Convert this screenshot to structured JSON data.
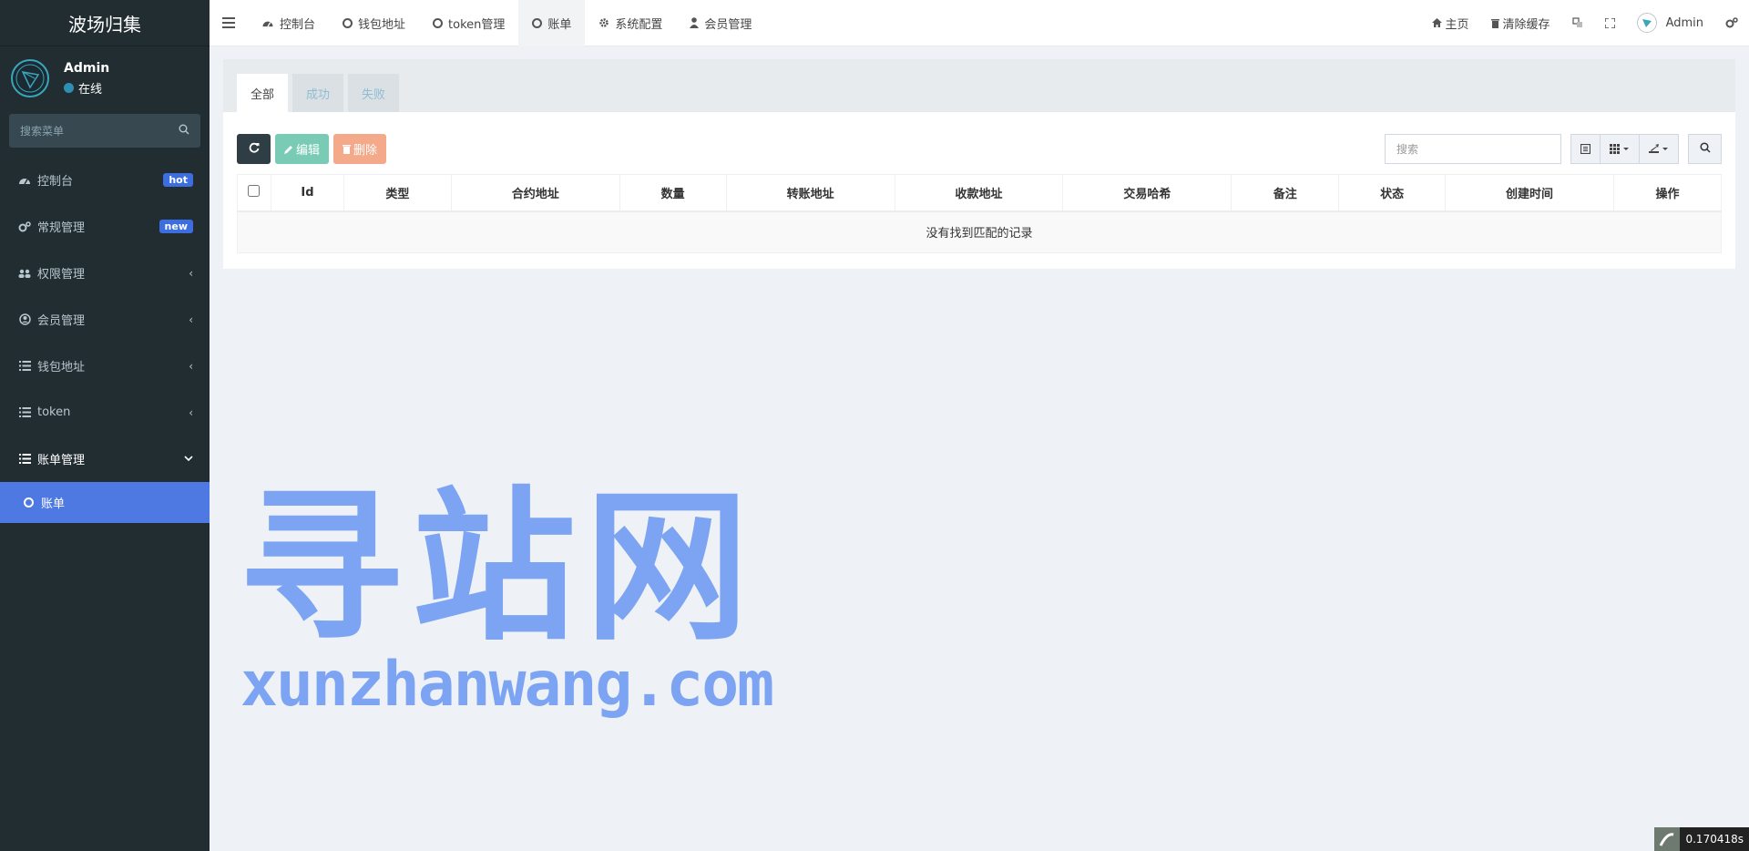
{
  "app": {
    "title": "波场归集"
  },
  "user": {
    "name": "Admin",
    "status": "在线"
  },
  "sidebar": {
    "search_placeholder": "搜索菜单",
    "items": [
      {
        "label": "控制台",
        "icon": "dashboard-icon",
        "badge": "hot"
      },
      {
        "label": "常规管理",
        "icon": "cogs-icon",
        "badge": "new"
      },
      {
        "label": "权限管理",
        "icon": "group-icon"
      },
      {
        "label": "会员管理",
        "icon": "user-circle-icon"
      },
      {
        "label": "钱包地址",
        "icon": "list-icon"
      },
      {
        "label": "token",
        "icon": "list-icon"
      },
      {
        "label": "账单管理",
        "icon": "list-icon"
      }
    ],
    "active_sub": {
      "label": "账单"
    }
  },
  "topbar": {
    "tabs": [
      "控制台",
      "钱包地址",
      "token管理",
      "账单",
      "系统配置",
      "会员管理"
    ],
    "right": {
      "home": "主页",
      "clear_cache": "清除缓存",
      "admin": "Admin"
    }
  },
  "panel": {
    "tabs": [
      "全部",
      "成功",
      "失败"
    ],
    "buttons": {
      "edit": "编辑",
      "delete": "删除"
    },
    "search_placeholder": "搜索",
    "columns": [
      "Id",
      "类型",
      "合约地址",
      "数量",
      "转账地址",
      "收款地址",
      "交易哈希",
      "备注",
      "状态",
      "创建时间",
      "操作"
    ],
    "empty_text": "没有找到匹配的记录"
  },
  "watermark": {
    "cn": "寻站网",
    "en": "xunzhanwang.com"
  },
  "timer": "0.170418s",
  "colors": {
    "sidebar_bg": "#222d32",
    "active_menu": "#4e79e3",
    "badge": "#3c6ee0",
    "edit_btn": "#79cbb6",
    "delete_btn": "#f3a98a",
    "watermark": "#7ca4f2"
  }
}
